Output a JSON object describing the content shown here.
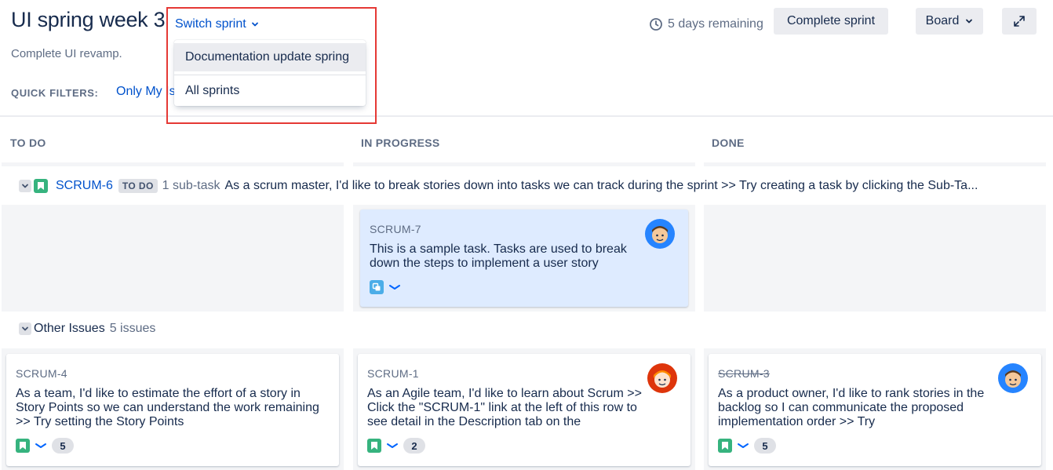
{
  "header": {
    "title": "UI spring week 3",
    "switch_sprint": "Switch sprint",
    "subtitle": "Complete UI revamp.",
    "time_remaining": "5 days remaining",
    "complete_sprint": "Complete sprint",
    "board": "Board"
  },
  "quick_filters": {
    "label": "QUICK FILTERS:",
    "only_my_issues": "Only My Issues"
  },
  "sprint_menu": {
    "items": [
      "Documentation update spring",
      "All sprints"
    ]
  },
  "columns": [
    "TO DO",
    "IN PROGRESS",
    "DONE"
  ],
  "swimlane": {
    "key": "SCRUM-6",
    "status": "TO DO",
    "subtasks": "1 sub-task",
    "summary": "As a scrum master, I'd like to break stories down into tasks we can track during the sprint >> Try creating a task by clicking the Sub-Ta..."
  },
  "subtask_card": {
    "key": "SCRUM-7",
    "summary": "This is a sample task. Tasks are used to break down the steps to implement a user story"
  },
  "other_issues": {
    "label": "Other Issues",
    "count": "5 issues"
  },
  "cards": [
    {
      "key": "SCRUM-4",
      "summary": "As a team, I'd like to estimate the effort of a story in Story Points so we can understand the work remaining >> Try setting the Story Points",
      "points": "5"
    },
    {
      "key": "SCRUM-1",
      "summary": "As an Agile team, I'd like to learn about Scrum >> Click the \"SCRUM-1\" link at the left of this row to see detail in the Description tab on the",
      "points": "2"
    },
    {
      "key": "SCRUM-3",
      "summary": "As a product owner, I'd like to rank stories in the backlog so I can communicate the proposed implementation order >> Try",
      "points": "5"
    }
  ],
  "icons": [
    "clock-icon",
    "chevron-down-icon",
    "expand-icon",
    "story-icon",
    "subtask-icon",
    "priority-low-icon"
  ],
  "colors": {
    "link": "#0052cc",
    "story": "#36b37e",
    "subtask": "#4bade8",
    "selected_card": "#deebff",
    "highlight": "#e53935"
  }
}
